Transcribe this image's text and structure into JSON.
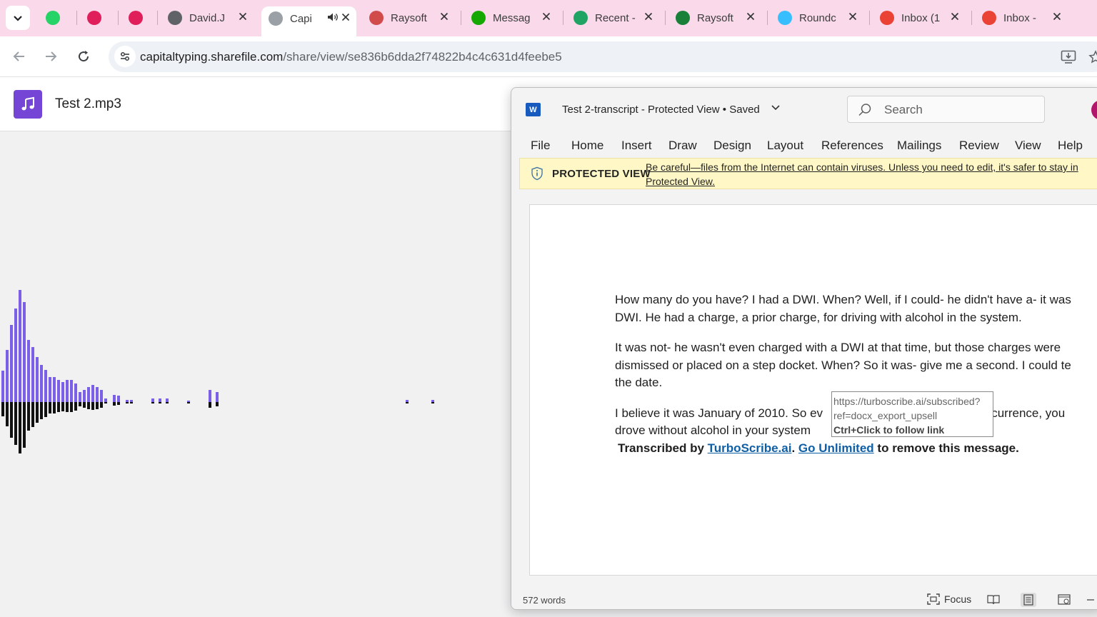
{
  "browser": {
    "tabs": [
      {
        "icon": "whatsapp-icon",
        "color": "#25d366",
        "title": "",
        "closable": false
      },
      {
        "icon": "slack-icon",
        "color": "#e01e5a",
        "title": "",
        "closable": false
      },
      {
        "icon": "slack-icon",
        "color": "#e01e5a",
        "title": "",
        "closable": false
      },
      {
        "icon": "globe-icon",
        "color": "#5f6368",
        "title": "David.J",
        "closable": true
      },
      {
        "icon": "sharefile-icon",
        "color": "#9aa0a6",
        "title": "Capi",
        "closable": true,
        "active": true,
        "audio": true
      },
      {
        "icon": "raysoft-icon",
        "color": "#d24b4b",
        "title": "Raysoft",
        "closable": true
      },
      {
        "icon": "upwork-icon",
        "color": "#14a800",
        "title": "Messag",
        "closable": true
      },
      {
        "icon": "google-drive-icon",
        "color": "#1fa463",
        "title": "Recent -",
        "closable": true
      },
      {
        "icon": "google-sheets-icon",
        "color": "#188038",
        "title": "Raysoft",
        "closable": true
      },
      {
        "icon": "roundcube-icon",
        "color": "#37beff",
        "title": "Roundc",
        "closable": true
      },
      {
        "icon": "gmail-icon",
        "color": "#ea4335",
        "title": "Inbox (1",
        "closable": true
      },
      {
        "icon": "gmail-icon",
        "color": "#ea4335",
        "title": "Inbox -",
        "closable": true
      }
    ],
    "url_host": "capitaltyping.sharefile.com",
    "url_path": "/share/view/se836b6dda2f74822b4c4c631d4feebe5"
  },
  "sharefile": {
    "file_name": "Test 2.mp3",
    "waveform_levels": [
      0.25,
      0.42,
      0.62,
      0.75,
      0.9,
      0.8,
      0.5,
      0.44,
      0.36,
      0.3,
      0.26,
      0.2,
      0.2,
      0.18,
      0.16,
      0.18,
      0.18,
      0.15,
      0.08,
      0.1,
      0.12,
      0.14,
      0.12,
      0.1,
      0.03,
      0.0,
      0.06,
      0.05,
      0.0,
      0.02,
      0.02,
      0.0,
      0.0,
      0.03,
      0.03,
      0.03,
      0.0,
      0.0,
      0.01,
      0.0,
      0.0,
      0.1,
      0.08
    ]
  },
  "word": {
    "doc_title": "Test 2-transcript  -  Protected View • Saved",
    "search_placeholder": "Search",
    "menu": [
      "File",
      "Home",
      "Insert",
      "Draw",
      "Design",
      "Layout",
      "References",
      "Mailings",
      "Review",
      "View",
      "Help"
    ],
    "protected_label": "PROTECTED VIEW",
    "protected_message": "Be careful—files from the Internet can contain viruses. Unless you need to edit, it's safer to stay in Protected View.",
    "paragraphs": [
      [
        "How many do you have? I had a DWI. When? Well, if I could- he didn't have a- it was",
        "DWI. He had a charge, a prior charge, for driving with alcohol in the system."
      ],
      [
        "It was not- he wasn't even charged with a DWI at that time, but those charges were",
        "dismissed or placed on a step docket. When? So it was- give me a second. I could te",
        "the date."
      ],
      [
        "I believe it was January of 2010. So ev                                          or occurrence, you",
        "drove without alcohol in your system                                     ny?"
      ]
    ],
    "credit_prefix": "Transcribed by",
    "credit_link": "TurboScribe.ai",
    "credit_sep": ".",
    "credit_cta": "Go Unlimited",
    "credit_suffix": "to remove this message.",
    "tooltip_url_1": "https://turboscribe.ai/subscribed?",
    "tooltip_url_2": "ref=docx_export_upsell",
    "tooltip_cmd": "Ctrl+Click to follow link",
    "word_count": "572 words",
    "focus_label": "Focus"
  }
}
